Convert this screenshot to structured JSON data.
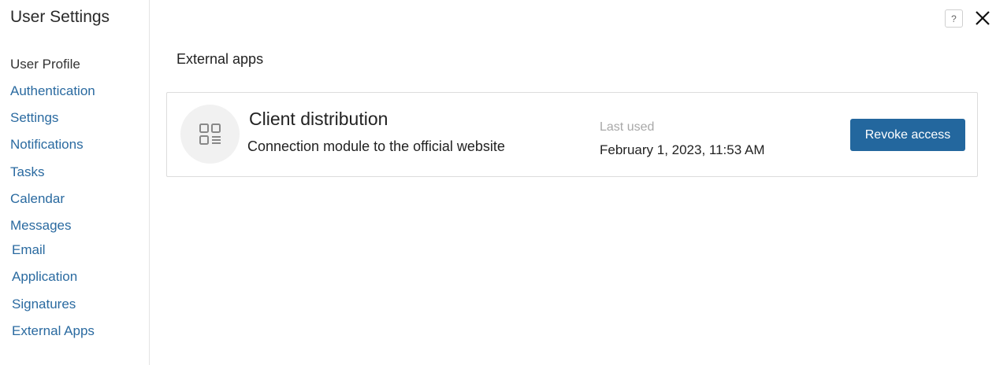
{
  "sidebar": {
    "title": "User Settings",
    "items": [
      {
        "label": "User Profile"
      },
      {
        "label": "Authentication"
      },
      {
        "label": "Settings"
      },
      {
        "label": "Notifications"
      },
      {
        "label": "Tasks"
      },
      {
        "label": "Calendar"
      },
      {
        "label": "Messages"
      },
      {
        "label": "Email"
      },
      {
        "label": "Application"
      },
      {
        "label": "Signatures"
      },
      {
        "label": "External Apps"
      }
    ]
  },
  "header": {
    "help_icon": "question-icon",
    "help_glyph": "?",
    "close_icon": "close-icon"
  },
  "main": {
    "section_title": "External apps",
    "apps": [
      {
        "name": "Client distribution",
        "description": "Connection module to the official website",
        "last_used_label": "Last used",
        "last_used_value": "February 1, 2023, 11:53 AM",
        "revoke_label": "Revoke access",
        "icon": "app-grid-icon"
      }
    ]
  },
  "colors": {
    "link": "#2a6aa0",
    "button": "#23679e",
    "muted": "#a8a8a8"
  }
}
